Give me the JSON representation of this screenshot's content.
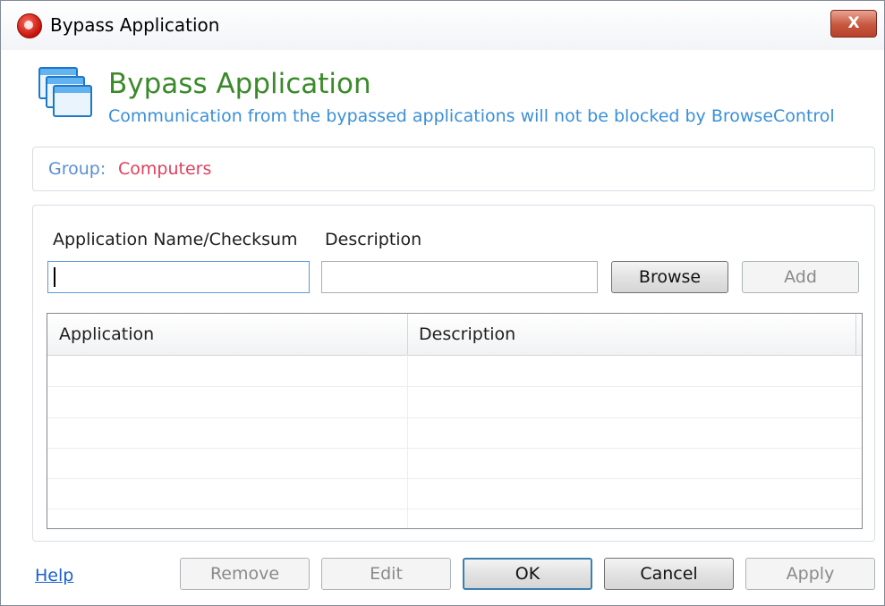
{
  "window": {
    "title": "Bypass Application",
    "close_glyph": "X"
  },
  "header": {
    "title": "Bypass Application",
    "subtitle": "Communication from the bypassed applications will not be blocked by BrowseControl",
    "icon": "windows-stack-icon"
  },
  "group": {
    "label": "Group:",
    "value": "Computers"
  },
  "form": {
    "name_label": "Application Name/Checksum",
    "description_label": "Description",
    "name_value": "",
    "description_value": "",
    "browse_label": "Browse",
    "add_label": "Add"
  },
  "table": {
    "columns": [
      "Application",
      "Description"
    ],
    "rows": []
  },
  "footer": {
    "help_label": "Help",
    "remove_label": "Remove",
    "edit_label": "Edit",
    "ok_label": "OK",
    "cancel_label": "Cancel",
    "apply_label": "Apply"
  },
  "colors": {
    "title_green": "#3a8a2a",
    "subtitle_blue": "#3a8fd8",
    "group_value_red": "#e0405e",
    "close_red": "#c7573f"
  }
}
